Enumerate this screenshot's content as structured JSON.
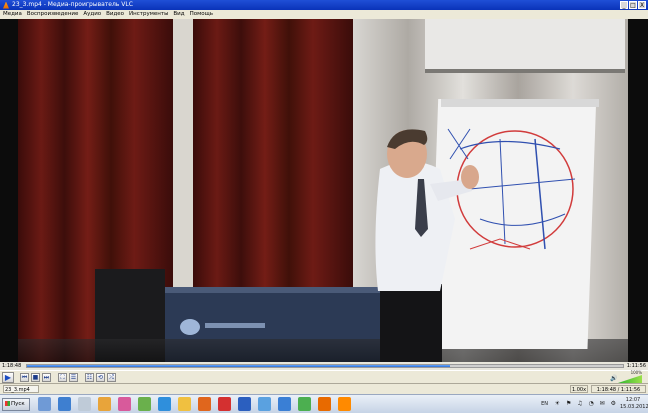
{
  "window": {
    "title": "23_3.mp4 - Медиа-проигрыватель VLC",
    "buttons": [
      "_",
      "□",
      "X"
    ]
  },
  "menu": [
    "Медиа",
    "Воспроизведение",
    "Аудио",
    "Видео",
    "Инструменты",
    "Вид",
    "Помощь"
  ],
  "player": {
    "time_elapsed": "1:18:48",
    "time_total": "1:11:56",
    "progress_fraction": 0.71,
    "volume_level": "100%",
    "speed": "1.00x",
    "status_time": "1:18:48 / 1:11:56",
    "filename": "23_3.mp4"
  },
  "controls": [
    {
      "name": "play-button",
      "glyph": "▶"
    },
    {
      "name": "prev-button",
      "glyph": "⏮"
    },
    {
      "name": "stop-button",
      "glyph": "■"
    },
    {
      "name": "next-button",
      "glyph": "⏭"
    },
    {
      "name": "fullscreen-button",
      "glyph": "⛶"
    },
    {
      "name": "extended-settings-button",
      "glyph": "☰"
    },
    {
      "name": "playlist-button",
      "glyph": "☷"
    },
    {
      "name": "loop-button",
      "glyph": "⟲"
    },
    {
      "name": "shuffle-button",
      "glyph": "⤮"
    }
  ],
  "taskbar": {
    "start_label": "Пуск",
    "lang": "EN",
    "clock_time": "12:07",
    "clock_date": "15.03.2012",
    "tray_icons": "☀ ⚑ ♫ ◔ ✉ ⚙"
  },
  "colors": {
    "title_bar": "#0a33b8",
    "seek_fill": "#2f6fd6",
    "volume_ramp": "#2fb52f"
  }
}
